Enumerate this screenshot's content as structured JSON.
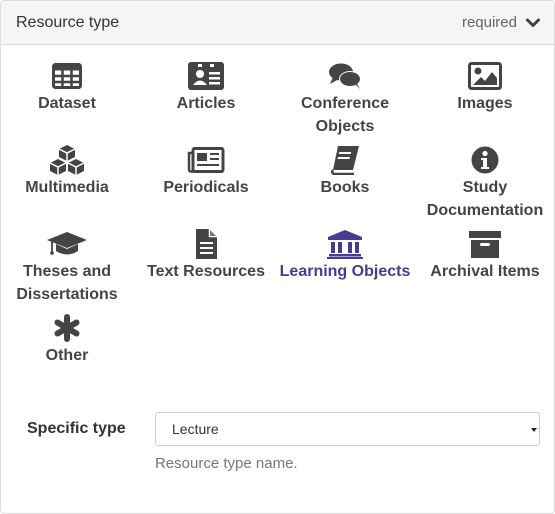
{
  "header": {
    "title": "Resource type",
    "required_label": "required",
    "chevron_icon": "chevron-down-icon"
  },
  "resource_types": [
    {
      "label": "Dataset",
      "icon": "table-icon"
    },
    {
      "label": "Articles",
      "icon": "id-card-icon"
    },
    {
      "label": "Conference Objects",
      "icon": "comments-icon"
    },
    {
      "label": "Images",
      "icon": "image-icon"
    },
    {
      "label": "Multimedia",
      "icon": "cubes-icon"
    },
    {
      "label": "Periodicals",
      "icon": "newspaper-icon"
    },
    {
      "label": "Books",
      "icon": "book-icon"
    },
    {
      "label": "Study Documentation",
      "icon": "info-circle-icon"
    },
    {
      "label": "Theses and Dissertations",
      "icon": "graduation-cap-icon"
    },
    {
      "label": "Text Resources",
      "icon": "file-text-icon"
    },
    {
      "label": "Learning Objects",
      "icon": "university-icon",
      "selected": true
    },
    {
      "label": "Archival Items",
      "icon": "archive-icon"
    },
    {
      "label": "Other",
      "icon": "asterisk-icon"
    }
  ],
  "colors": {
    "selected": "#4a3b8c",
    "icon": "#444444"
  },
  "specific_type": {
    "label": "Specific type",
    "value": "Lecture",
    "help": "Resource type name."
  }
}
